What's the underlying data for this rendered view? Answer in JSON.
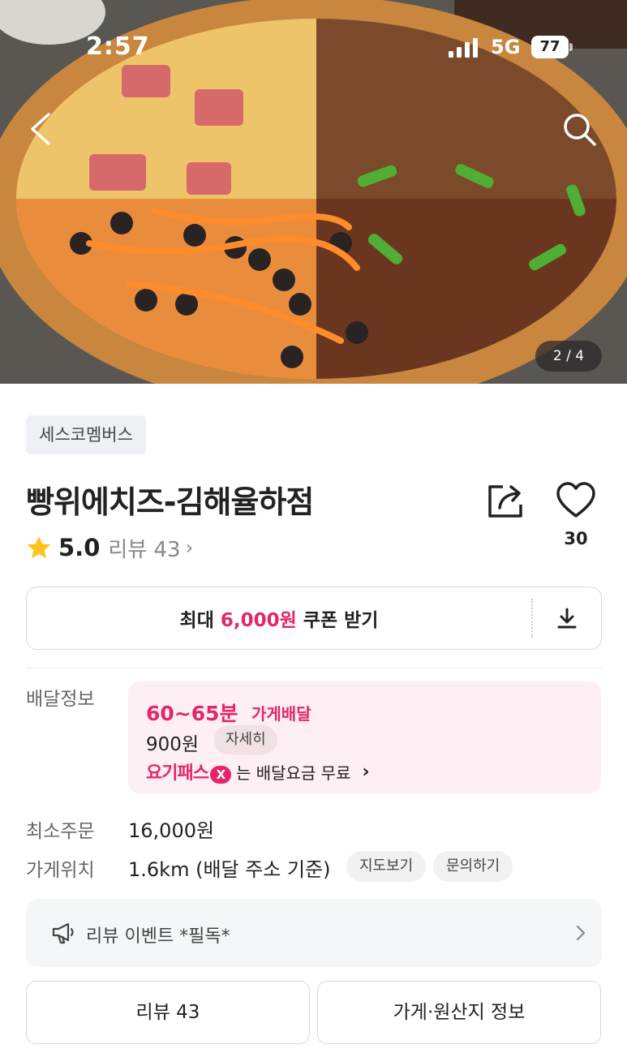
{
  "status_bar": {
    "time": "2:57",
    "network": "5G",
    "battery": "77"
  },
  "hero": {
    "pager": "2 / 4",
    "back_icon": "chevron-left-icon",
    "search_icon": "search-icon"
  },
  "store": {
    "category_tag": "세스코멤버스",
    "name": "빵위에치즈-김해율하점",
    "rating": "5.0",
    "review_label": "리뷰 43",
    "review_chevron": "›",
    "like_count": "30",
    "share_icon": "share-icon",
    "heart_icon": "heart-icon"
  },
  "coupon": {
    "prefix": "최대",
    "amount": "6,000원",
    "suffix": "쿠폰 받기",
    "download_icon": "download-icon"
  },
  "delivery": {
    "label": "배달정보",
    "time": "60~65분",
    "type": "가게배달",
    "fee": "900원",
    "detail_chip": "자세히",
    "pass_logo": "요기패스",
    "pass_x": "X",
    "pass_text": "는 배달요금 무료",
    "pass_chevron": "›"
  },
  "min_order": {
    "label": "최소주문",
    "value": "16,000원"
  },
  "location": {
    "label": "가게위치",
    "value": "1.6km (배달 주소 기준)",
    "map_chip": "지도보기",
    "inquiry_chip": "문의하기"
  },
  "event": {
    "text": "리뷰 이벤트 *필독*",
    "icon": "megaphone-icon"
  },
  "bottom_tabs": {
    "reviews": "리뷰 43",
    "info": "가게·원산지 정보"
  },
  "colors": {
    "accent": "#e5256b",
    "delivery_bg": "#fdeff3",
    "star": "#ffc21a"
  }
}
